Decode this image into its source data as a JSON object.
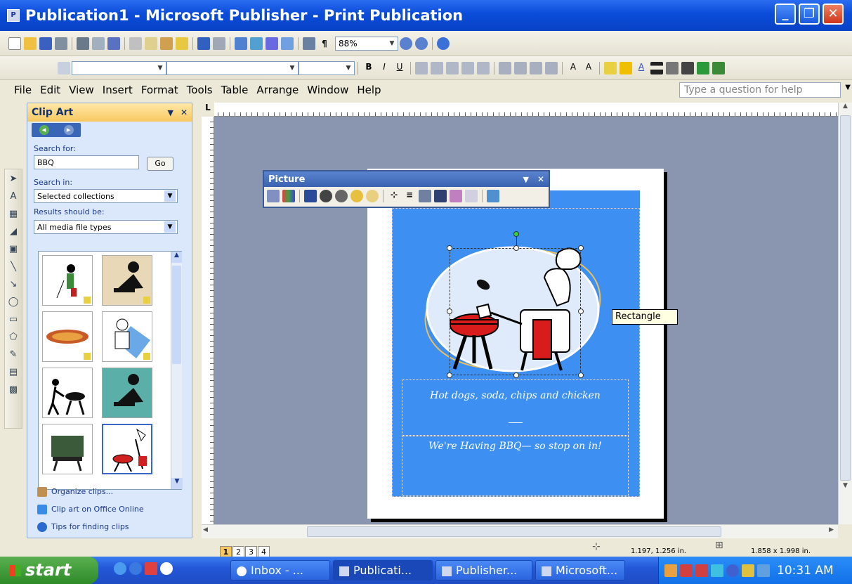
{
  "window": {
    "title": "Publication1 - Microsoft Publisher - Print Publication"
  },
  "toolbar": {
    "zoom": "88%"
  },
  "menu": {
    "items": [
      "File",
      "Edit",
      "View",
      "Insert",
      "Format",
      "Tools",
      "Table",
      "Arrange",
      "Window",
      "Help"
    ],
    "help_placeholder": "Type a question for help"
  },
  "taskpane": {
    "title": "Clip Art",
    "search_for_label": "Search for:",
    "search_value": "BBQ",
    "go_label": "Go",
    "search_in_label": "Search in:",
    "search_in_value": "Selected collections",
    "results_label": "Results should be:",
    "results_value": "All media file types",
    "links": [
      "Organize clips...",
      "Clip art on Office Online",
      "Tips for finding clips"
    ]
  },
  "picture_toolbar": {
    "title": "Picture"
  },
  "publication": {
    "line1": "Hot dogs, soda, chips and chicken",
    "line2": "We're Having BBQ— so stop on in!"
  },
  "tooltip": "Rectangle",
  "status": {
    "pages": [
      "1",
      "2",
      "3",
      "4"
    ],
    "position": "1.197, 1.256 in.",
    "size": "1.858 x 1.998 in."
  },
  "taskbar": {
    "start": "start",
    "tasks": [
      "Inbox - ...",
      "Publicati...",
      "Publisher...",
      "Microsoft..."
    ],
    "clock": "10:31 AM"
  },
  "colors": {
    "accent": "#3d8ff2",
    "titlebar": "#0a4cd8",
    "taskpane": "#dbe7fa"
  }
}
